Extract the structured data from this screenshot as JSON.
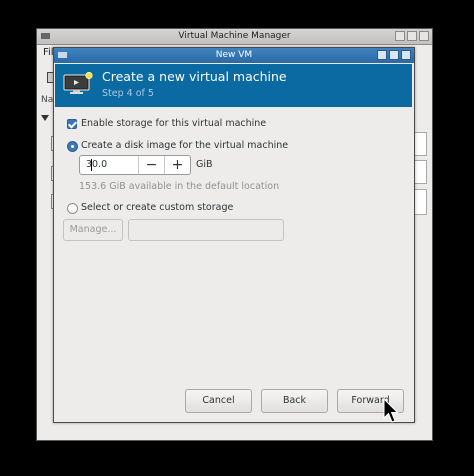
{
  "background_window": {
    "title": "Virtual Machine Manager",
    "menu_partial": "Fil",
    "column_partial": "Na"
  },
  "dialog": {
    "title": "New VM",
    "header": {
      "title": "Create a new virtual machine",
      "step": "Step 4 of 5",
      "icon": "monitor-new-icon"
    },
    "enable_storage": {
      "label": "Enable storage for this virtual machine",
      "checked": true
    },
    "disk_image": {
      "label": "Create a disk image for the virtual machine",
      "selected": true,
      "size_value": "30.0",
      "unit": "GiB",
      "minus": "−",
      "plus": "+",
      "available": "153.6 GiB available in the default location"
    },
    "custom_storage": {
      "label": "Select or create custom storage",
      "selected": false,
      "manage_button": "Manage...",
      "path_value": ""
    },
    "buttons": {
      "cancel": "Cancel",
      "back": "Back",
      "forward": "Forward"
    }
  }
}
